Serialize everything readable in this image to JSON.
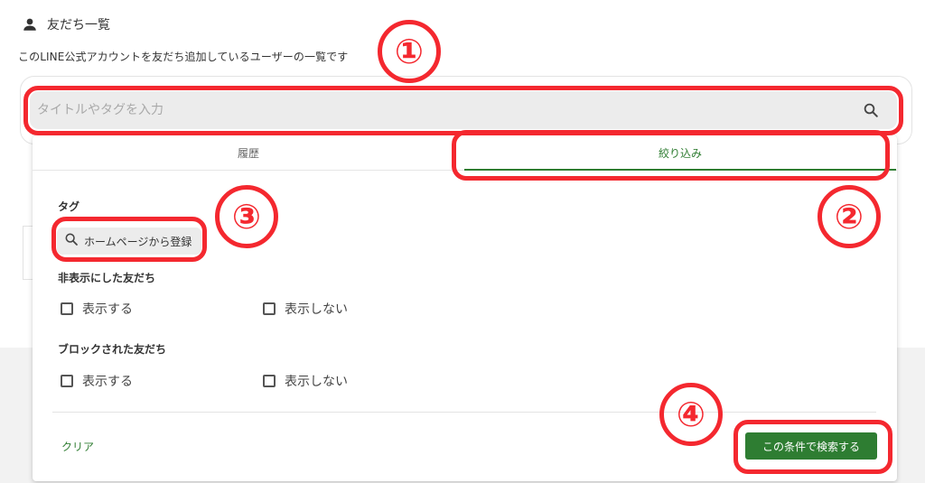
{
  "header": {
    "title": "友だち一覧",
    "description": "このLINE公式アカウントを友だち追加しているユーザーの一覧です",
    "icon": "person-icon"
  },
  "search": {
    "placeholder": "タイトルやタグを入力",
    "value": "",
    "icon": "search-icon"
  },
  "tabs": [
    {
      "label": "履歴",
      "active": false
    },
    {
      "label": "絞り込み",
      "active": true
    }
  ],
  "filter": {
    "tag_label": "タグ",
    "tag_search_text": "ホームページから登録",
    "hidden_friends": {
      "label": "非表示にした友だち",
      "options": [
        {
          "label": "表示する",
          "checked": false
        },
        {
          "label": "表示しない",
          "checked": false
        }
      ]
    },
    "blocked_friends": {
      "label": "ブロックされた友だち",
      "options": [
        {
          "label": "表示する",
          "checked": false
        },
        {
          "label": "表示しない",
          "checked": false
        }
      ]
    },
    "clear_label": "クリア",
    "submit_label": "この条件で検索する"
  },
  "annotations": {
    "n1": "①",
    "n2": "②",
    "n3": "③",
    "n4": "④",
    "color": "#f4282f"
  },
  "colors": {
    "accent_green": "#2e7d32",
    "tab_active": "#2f7d32",
    "input_bg": "#ececec"
  }
}
